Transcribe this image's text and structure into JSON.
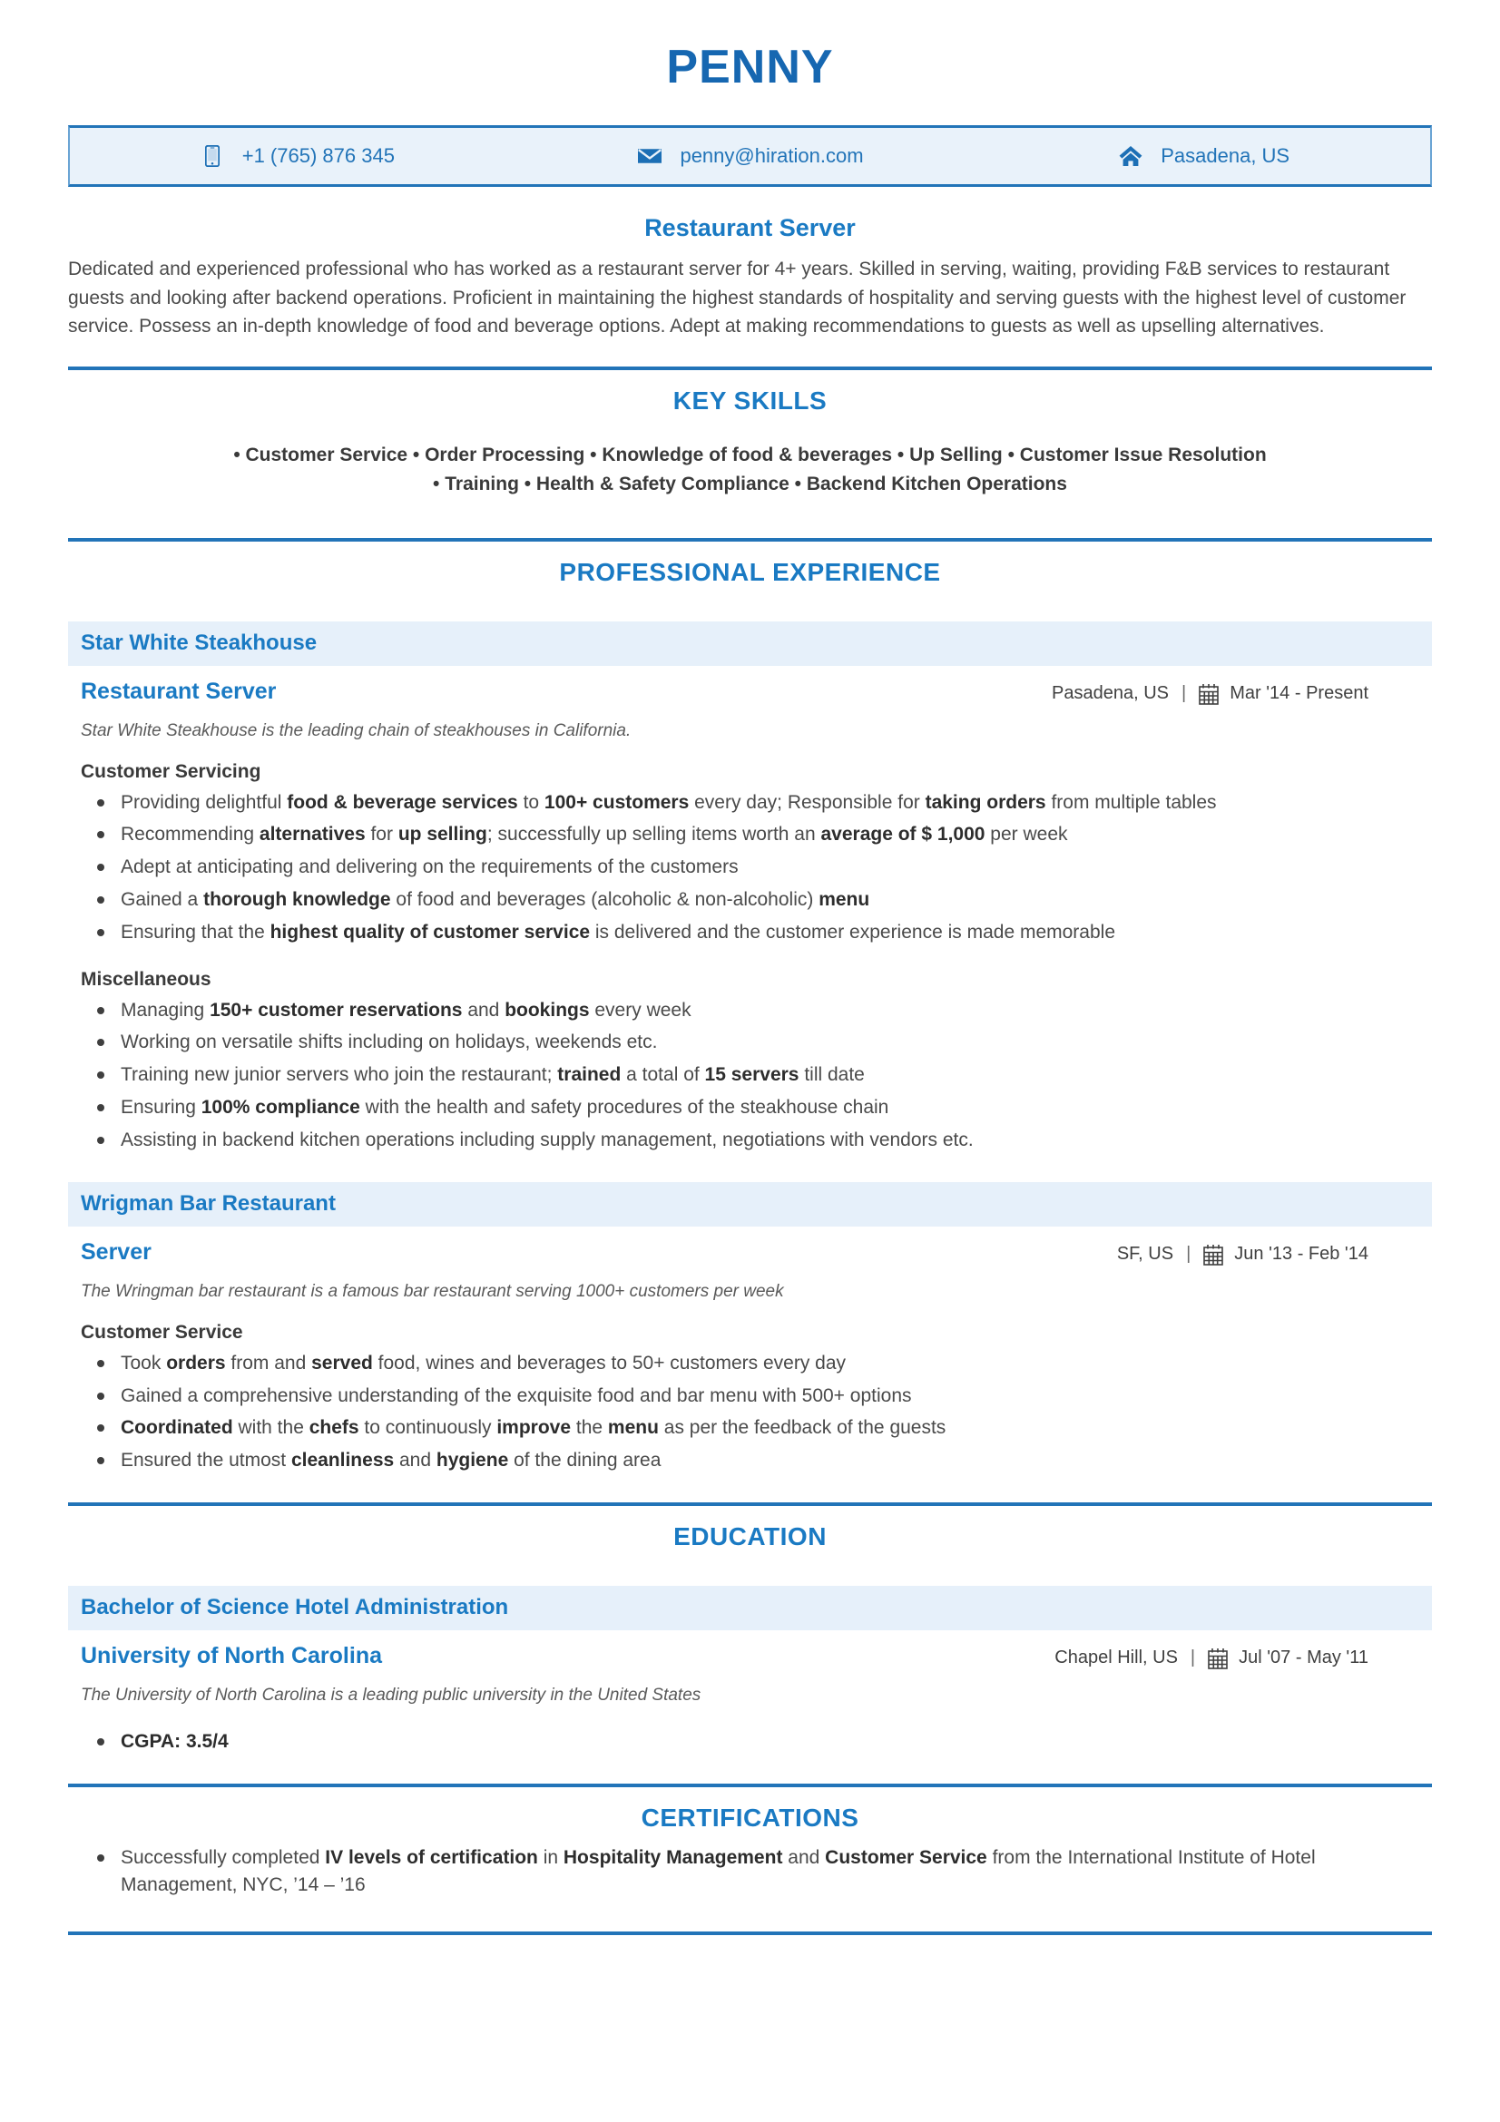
{
  "colors": {
    "primary_blue": "#1667b1",
    "heading_blue": "#1a7ac3",
    "bar_blue": "#2274b8",
    "light_blue_bg": "#e6f0fa",
    "contact_bg": "#e9f2fa",
    "body_text": "#4a4a4a"
  },
  "header": {
    "name": "PENNY",
    "contacts": [
      {
        "icon": "phone-icon",
        "text": "+1 (765) 876 345"
      },
      {
        "icon": "envelope-icon",
        "text": "penny@hiration.com"
      },
      {
        "icon": "home-icon",
        "text": "Pasadena, US"
      }
    ]
  },
  "profile": {
    "headline": "Restaurant Server",
    "summary": "Dedicated and experienced professional who has worked as a restaurant server for 4+ years. Skilled in serving, waiting, providing F&B services to restaurant guests and looking after backend operations. Proficient in maintaining the highest standards of hospitality and serving guests with the highest level of customer service. Possess an in-depth knowledge of food and beverage options. Adept at making recommendations to guests as well as upselling alternatives."
  },
  "key_skills": {
    "heading": "KEY SKILLS",
    "line1": "• Customer Service • Order Processing • Knowledge of food & beverages • Up Selling • Customer Issue Resolution",
    "line2": "• Training • Health & Safety Compliance • Backend Kitchen Operations",
    "items": [
      "Customer Service",
      "Order Processing",
      "Knowledge of food & beverages",
      "Up Selling",
      "Customer Issue Resolution",
      "Training",
      "Health & Safety Compliance",
      "Backend Kitchen Operations"
    ]
  },
  "experience": {
    "heading": "PROFESSIONAL EXPERIENCE",
    "jobs": [
      {
        "company": "Star White Steakhouse",
        "role": "Restaurant Server",
        "location": "Pasadena, US",
        "separator": "|",
        "dates": "Mar '14 -  Present",
        "description": "Star White Steakhouse is the leading chain of steakhouses in California.",
        "groups": [
          {
            "title": "Customer Servicing",
            "bullets": [
              "Providing delightful <b>food &amp; beverage services</b> to <b>100+ customers</b> every day; Responsible for <b>taking orders</b> from multiple tables",
              "Recommending <b>alternatives</b> for <b>up selling</b>; successfully up selling items worth an <b>average of $ 1,000</b> per week",
              "Adept at anticipating and delivering on the requirements of the customers",
              "Gained a <b>thorough knowledge</b> of food and beverages (alcoholic &amp; non-alcoholic) <b>menu</b>",
              "Ensuring that the <b>highest quality of customer service</b> is delivered and the customer experience is made memorable"
            ]
          },
          {
            "title": "Miscellaneous",
            "bullets": [
              "Managing <b>150+ customer reservations</b> and <b>bookings</b> every week",
              "Working on versatile shifts including on holidays, weekends etc.",
              "Training new junior servers who join the restaurant; <b>trained</b> a total of <b>15 servers</b> till date",
              "Ensuring <b>100% compliance</b> with the health and safety procedures of the steakhouse chain",
              "Assisting in backend kitchen operations including supply management, negotiations with vendors etc."
            ]
          }
        ]
      },
      {
        "company": "Wrigman Bar Restaurant",
        "role": "Server",
        "location": "SF, US",
        "separator": "|",
        "dates": "Jun '13 -  Feb '14",
        "description": "The Wringman bar restaurant is a famous bar restaurant serving 1000+ customers per week",
        "groups": [
          {
            "title": "Customer Service",
            "bullets": [
              "Took <b>orders</b> from and <b>served</b> food, wines and beverages to 50+ customers every day",
              "Gained a comprehensive understanding of the exquisite food and bar menu with 500+ options",
              "<b>Coordinated</b> with the <b>chefs</b> to continuously <b>improve</b> the <b>menu</b> as per the feedback of the guests",
              "Ensured the utmost <b>cleanliness</b> and <b>hygiene</b> of the dining area"
            ]
          }
        ]
      }
    ]
  },
  "education": {
    "heading": "EDUCATION",
    "entries": [
      {
        "degree": "Bachelor of Science Hotel Administration",
        "school": "University of North Carolina",
        "location": "Chapel Hill, US",
        "separator": "|",
        "dates": "Jul '07 -  May '11",
        "description": "The University of North Carolina is a leading public university in the United States",
        "bullets": [
          "<b>CGPA: 3.5/4</b>"
        ]
      }
    ]
  },
  "certifications": {
    "heading": "CERTIFICATIONS",
    "bullets": [
      "Successfully completed <b>IV levels of certification</b> in <b>Hospitality Management</b> and <b>Customer Service</b> from the International Institute of Hotel Management, NYC, ’14 – ’16"
    ]
  }
}
